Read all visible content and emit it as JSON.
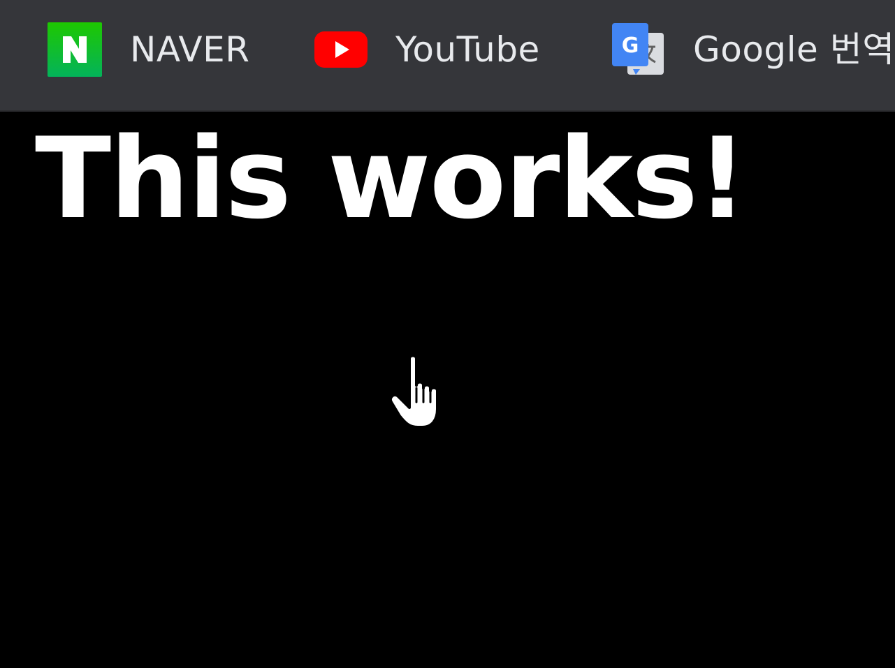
{
  "bookmarks": [
    {
      "label": "NAVER",
      "icon": "naver-icon"
    },
    {
      "label": "YouTube",
      "icon": "youtube-icon"
    },
    {
      "label": "Google 번역",
      "icon": "google-translate-icon"
    }
  ],
  "main": {
    "headline": "This works!"
  },
  "cursor": {
    "icon": "hand-pointer-cursor-icon"
  },
  "colors": {
    "bookmarks_bar_bg": "#35363a",
    "page_bg": "#000000",
    "text": "#ffffff",
    "naver_green": "#03c75a",
    "youtube_red": "#ff0000",
    "google_blue": "#4285f4"
  }
}
